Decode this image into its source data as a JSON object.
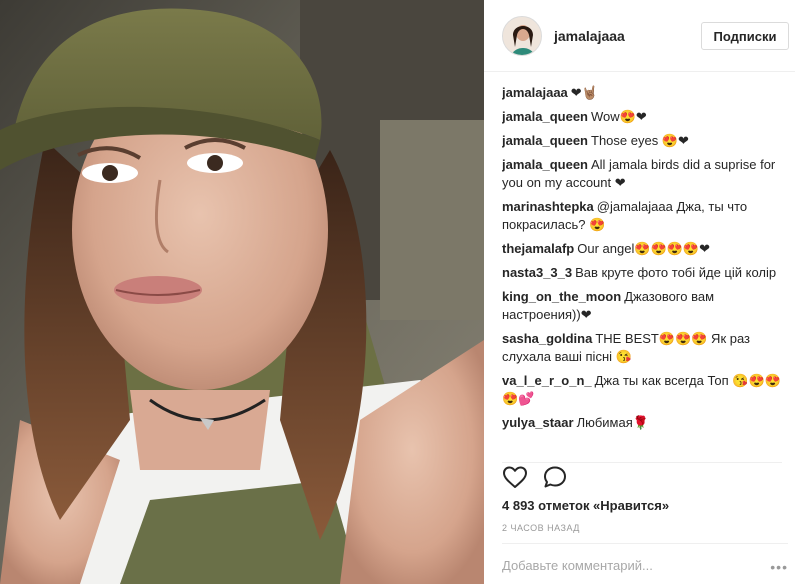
{
  "post": {
    "username": "jamalajaaa",
    "follow_label": "Подписки",
    "likes_text": "4 893 отметок «Нравится»",
    "time_ago": "2 ЧАСОВ НАЗАД",
    "comment_placeholder": "Добавьте комментарий...",
    "more_label": "•••"
  },
  "comments": [
    {
      "user": "jamalajaaa",
      "text": "❤🤘🏽"
    },
    {
      "user": "jamala_queen",
      "text": "Wow😍❤"
    },
    {
      "user": "jamala_queen",
      "text": "Those eyes 😍❤"
    },
    {
      "user": "jamala_queen",
      "text": "All jamala birds did a suprise for you on my account ❤"
    },
    {
      "user": "marinashtepka",
      "text": "@jamalajaaa Джа, ты что покрасилась? 😍"
    },
    {
      "user": "thejamalafp",
      "text": "Our angel😍😍😍😍❤"
    },
    {
      "user": "nasta3_3_3",
      "text": "Вав круте фото тобі йде цій колір"
    },
    {
      "user": "king_on_the_moon",
      "text": "Джазового вам настроения))❤"
    },
    {
      "user": "sasha_goldina",
      "text": "THE BEST😍😍😍 Як раз слухала ваші пісні 😘"
    },
    {
      "user": "va_l_e_r_o_n_",
      "text": "Джа ты как всегда Топ 😘😍😍😍💕"
    },
    {
      "user": "yulya_staar",
      "text": "Любимая🌹"
    }
  ],
  "icons": {
    "like": "heart-outline-icon",
    "comment": "comment-bubble-icon"
  },
  "colors": {
    "text": "#262626",
    "muted": "#999999",
    "border": "#efefef"
  }
}
